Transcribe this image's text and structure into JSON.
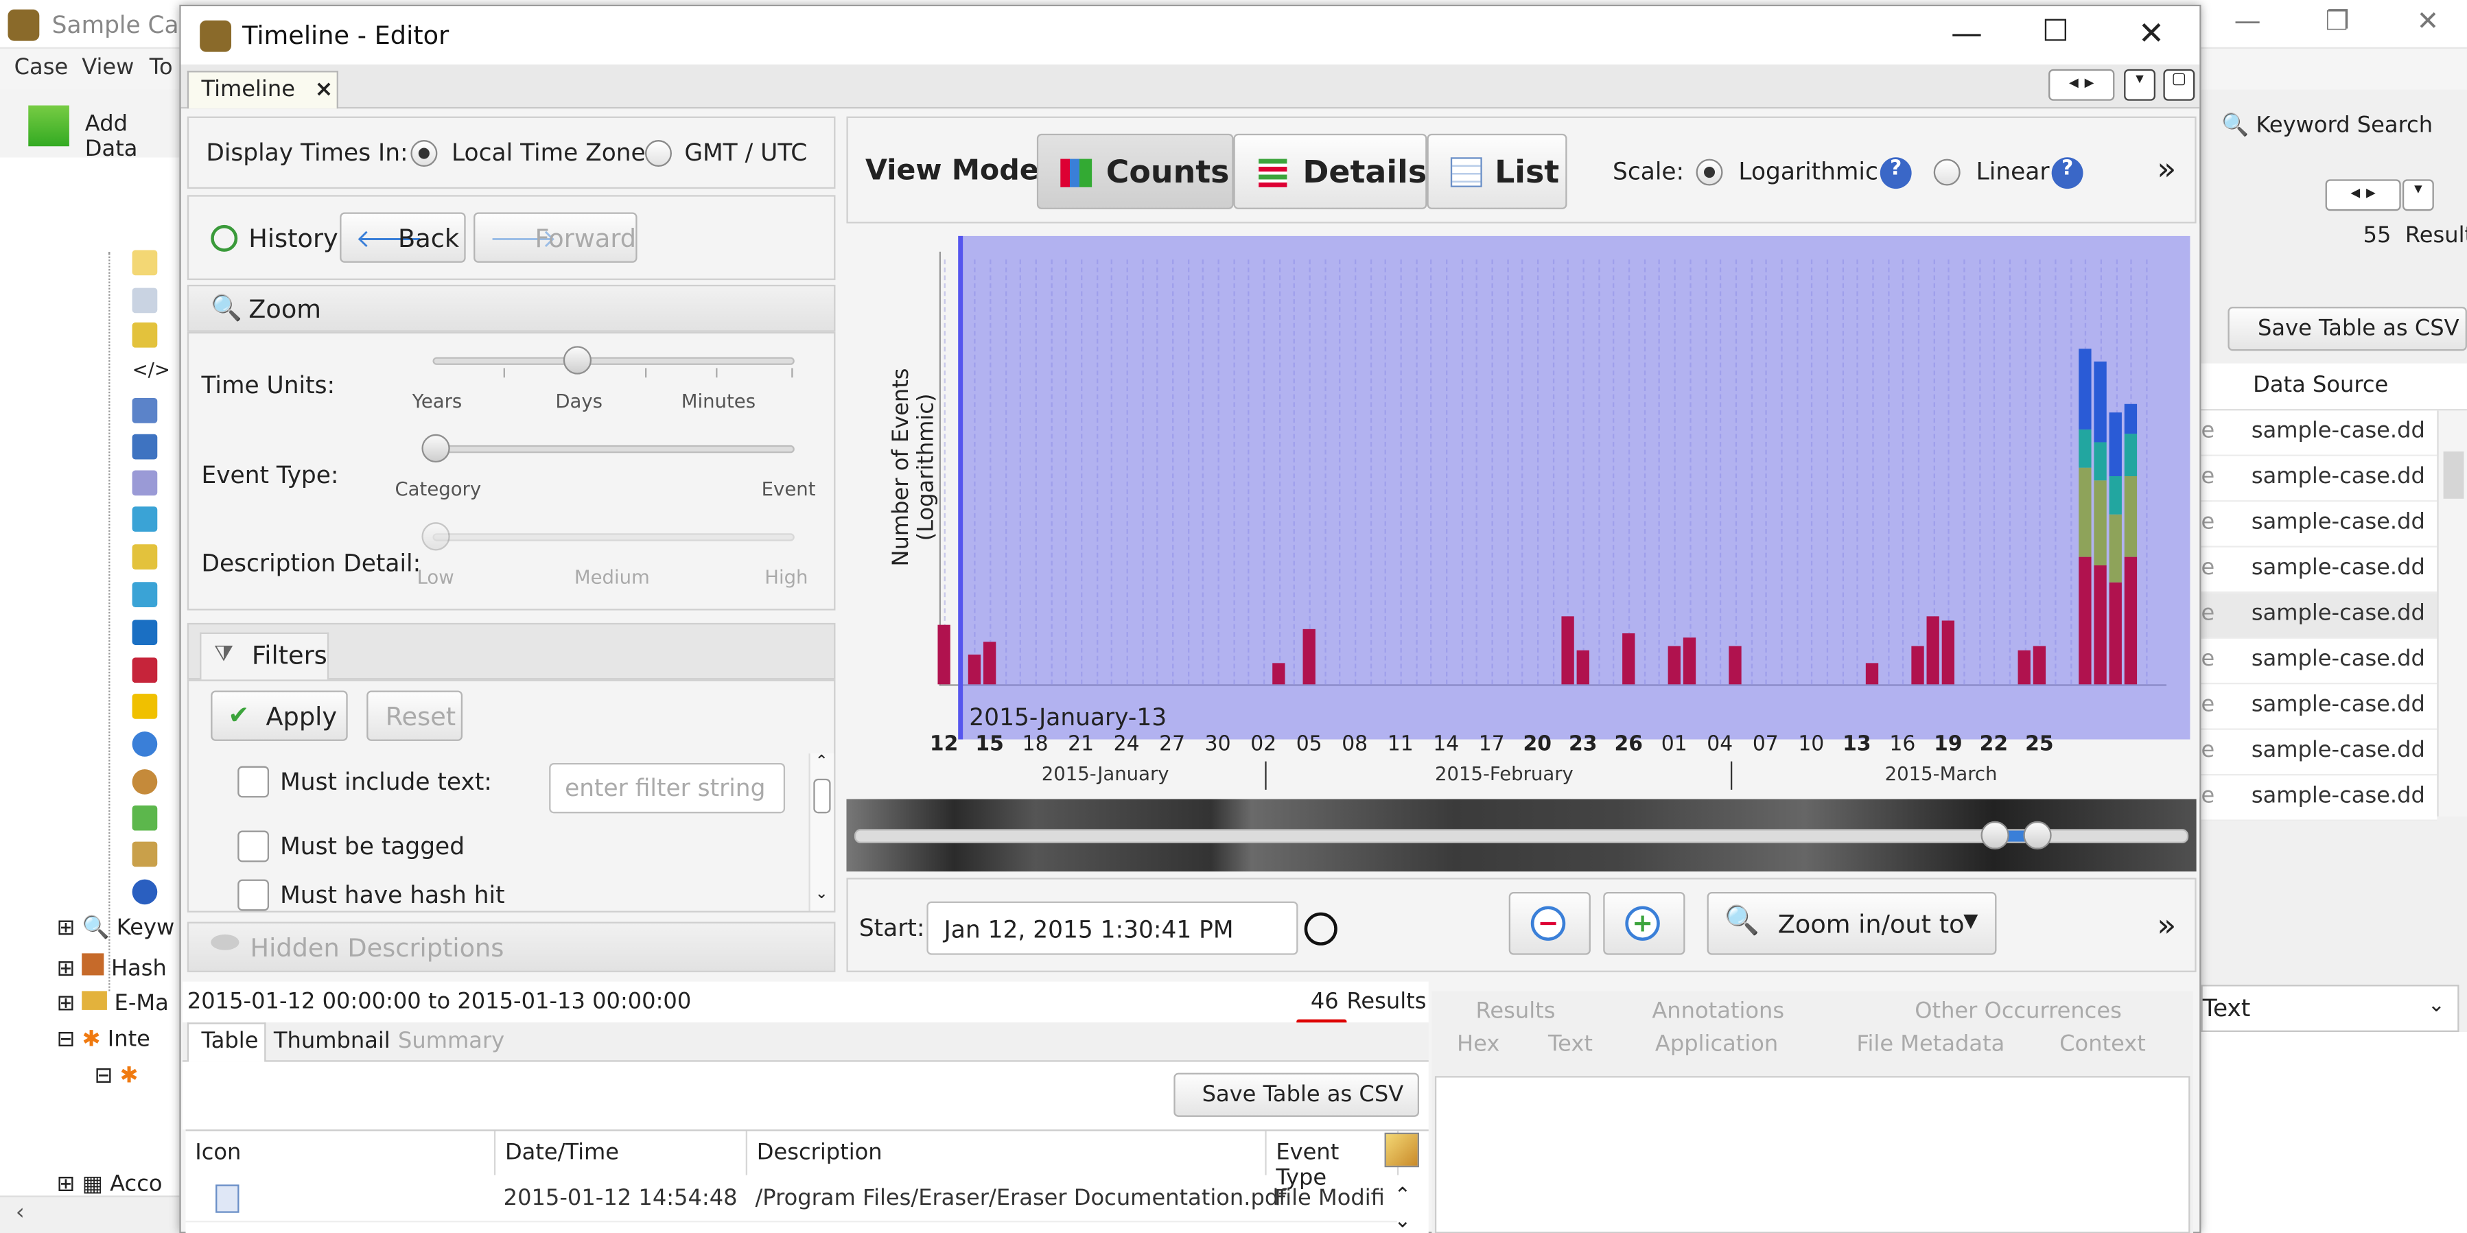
{
  "main_window": {
    "title": "Sample Cas",
    "menu": [
      "Case",
      "View",
      "To"
    ],
    "add_data": "Add Data",
    "keyword_search": "Keyword Search",
    "results_count": "55",
    "results_label": "Results",
    "save_csv": "Save Table as CSV",
    "column_data_source": "Data Source",
    "data_source_rows": [
      "sample-case.dd",
      "sample-case.dd",
      "sample-case.dd",
      "sample-case.dd",
      "sample-case.dd",
      "sample-case.dd",
      "sample-case.dd",
      "sample-case.dd",
      "sample-case.dd"
    ],
    "row_prefix": "e",
    "text_dropdown": "Text",
    "tree_items": [
      "Keyw",
      "Hash",
      "E-Ma",
      "Inte",
      "Acco"
    ]
  },
  "editor": {
    "title": "Timeline - Editor",
    "tab": "Timeline",
    "tab_close": "×",
    "display_times_label": "Display Times In:",
    "tz_local": "Local Time Zone",
    "tz_gmt": "GMT / UTC",
    "history": "History",
    "back": "Back",
    "forward": "Forward",
    "zoom_header": "Zoom",
    "time_units_label": "Time Units:",
    "time_units_ticks": [
      "Years",
      "Days",
      "Minutes"
    ],
    "event_type_label": "Event Type:",
    "event_type_ticks": [
      "Category",
      "Event"
    ],
    "desc_detail_label": "Description Detail:",
    "desc_detail_ticks": [
      "Low",
      "Medium",
      "High"
    ],
    "filters_header": "Filters",
    "apply": "Apply",
    "reset": "Reset",
    "filter_text": "Must include text:",
    "filter_placeholder": "enter filter string",
    "filter_tagged": "Must be tagged",
    "filter_hash": "Must have hash hit",
    "hidden_descriptions": "Hidden Descriptions",
    "view_mode_label": "View Mode:",
    "view_counts": "Counts",
    "view_details": "Details",
    "view_list": "List",
    "scale_label": "Scale:",
    "scale_log": "Logarithmic",
    "scale_linear": "Linear",
    "more": "»",
    "start_label": "Start:",
    "start_value": "Jan 12, 2015 1:30:41 PM",
    "zoom_to": "Zoom in/out to",
    "range_text": "2015-01-12 00:00:00 to 2015-01-13 00:00:00",
    "results_count": "46",
    "results_label": "Results",
    "table_tabs": [
      "Table",
      "Thumbnail",
      "Summary"
    ],
    "save_csv": "Save Table as CSV",
    "columns": [
      "Icon",
      "Date/Time",
      "Description",
      "Event Type"
    ],
    "row": {
      "datetime": "2015-01-12 14:54:48",
      "description": "/Program Files/Eraser/Eraser Documentation.pdf",
      "event_type": "File Modifiec"
    },
    "content_tabs_top": [
      "Results",
      "Annotations",
      "Other Occurrences"
    ],
    "content_tabs_bottom": [
      "Hex",
      "Text",
      "Application",
      "File Metadata",
      "Context"
    ]
  },
  "colors": {
    "selection": "#7c7cec",
    "bar_red": "#b0124e",
    "bar_olive": "#8ea35a",
    "bar_teal": "#22a6a0",
    "bar_blue": "#2a5bd6",
    "accent_green": "#3ca43c"
  },
  "chart_data": {
    "type": "bar",
    "ylabel": "Number of Events (Logarithmic)",
    "selection_label": "2015-January-13",
    "x_ticks": [
      "12",
      "15",
      "18",
      "21",
      "24",
      "27",
      "30",
      "02",
      "05",
      "08",
      "11",
      "14",
      "17",
      "20",
      "23",
      "26",
      "01",
      "04",
      "07",
      "10",
      "13",
      "16",
      "19",
      "22",
      "25"
    ],
    "bold_ticks": [
      "12",
      "15",
      "20",
      "23",
      "26",
      "13",
      "19",
      "22",
      "25"
    ],
    "months": [
      "2015-January",
      "2015-February",
      "2015-March"
    ],
    "series": [
      {
        "name": "",
        "color": "#b0124e",
        "points": [
          [
            0,
            0.14
          ],
          [
            2,
            0.07
          ],
          [
            3,
            0.1
          ],
          [
            22,
            0.05
          ],
          [
            24,
            0.13
          ],
          [
            41,
            0.16
          ],
          [
            42,
            0.08
          ],
          [
            45,
            0.12
          ],
          [
            48,
            0.09
          ],
          [
            49,
            0.11
          ],
          [
            52,
            0.09
          ],
          [
            61,
            0.05
          ],
          [
            64,
            0.09
          ],
          [
            65,
            0.16
          ],
          [
            66,
            0.15
          ],
          [
            71,
            0.08
          ],
          [
            72,
            0.09
          ],
          [
            75,
            0.3
          ],
          [
            76,
            0.28
          ],
          [
            77,
            0.24
          ],
          [
            78,
            0.3
          ]
        ]
      },
      {
        "name": "",
        "color": "#8ea35a",
        "points": [
          [
            75,
            0.21
          ],
          [
            76,
            0.2
          ],
          [
            77,
            0.16
          ],
          [
            78,
            0.19
          ]
        ]
      },
      {
        "name": "",
        "color": "#22a6a0",
        "points": [
          [
            75,
            0.09
          ],
          [
            76,
            0.09
          ],
          [
            77,
            0.09
          ],
          [
            78,
            0.1
          ]
        ]
      },
      {
        "name": "",
        "color": "#2a5bd6",
        "points": [
          [
            75,
            0.19
          ],
          [
            76,
            0.19
          ],
          [
            77,
            0.15
          ],
          [
            78,
            0.07
          ]
        ]
      }
    ]
  }
}
